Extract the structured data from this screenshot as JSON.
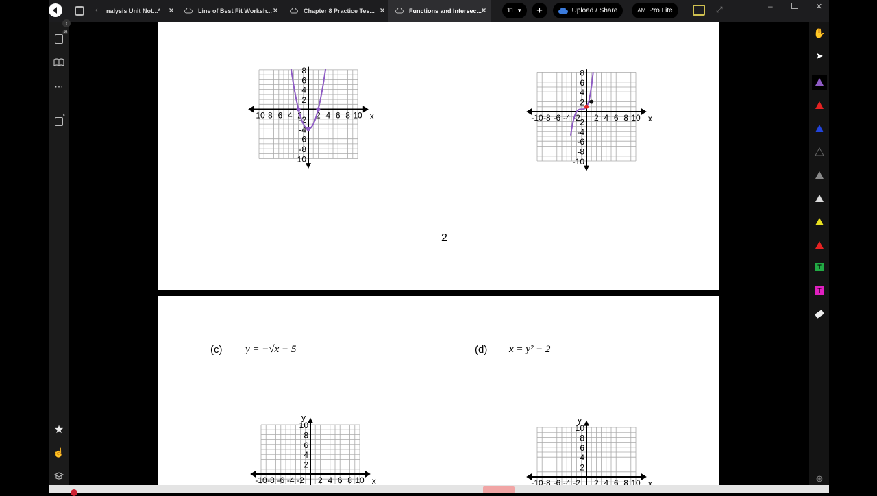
{
  "tabs": [
    {
      "label": "nalysis Unit Not...*",
      "cloud": false
    },
    {
      "label": "Line of Best Fit Worksh...",
      "cloud": true
    },
    {
      "label": "Chapter 8 Practice Tes...",
      "cloud": true
    },
    {
      "label": "Functions and Intersec...*",
      "cloud": true,
      "active": true
    }
  ],
  "page_count": "11",
  "upload_label": "Upload / Share",
  "plan_label": "Pro Lite",
  "avatar_initials": "AM",
  "left_badge": "10",
  "page_number": "2",
  "graphs_top": {
    "left": {
      "ticks": [
        "-10",
        "-8",
        "-6",
        "-4",
        "-2",
        "2",
        "4",
        "6",
        "8",
        "10"
      ],
      "yticks": [
        "8",
        "6",
        "4",
        "2",
        "-2",
        "-4",
        "-6",
        "-8",
        "-10"
      ],
      "xaxis": "x"
    },
    "right": {
      "ticks": [
        "-10",
        "-8",
        "-6",
        "-4",
        "-2",
        "2",
        "4",
        "6",
        "8",
        "10"
      ],
      "yticks": [
        "8",
        "6",
        "4",
        "2",
        "-2",
        "-4",
        "-6",
        "-8",
        "-10"
      ],
      "xaxis": "x"
    }
  },
  "problems": {
    "c": {
      "label": "(c)",
      "equation": "y = −√x − 5"
    },
    "d": {
      "label": "(d)",
      "equation": "x = y² − 2"
    }
  },
  "graphs_bottom": {
    "xticks": [
      "-10",
      "-8",
      "-6",
      "-4",
      "-2",
      "2",
      "4",
      "6",
      "8",
      "10"
    ],
    "yticks": [
      "10",
      "8",
      "6",
      "4",
      "2"
    ],
    "yaxis": "y",
    "xaxis": "x"
  },
  "colors": {
    "ink_purple": "#8e5bc4",
    "tab_bg": "#1d1d1f",
    "accent_blue": "#3b7bdc"
  }
}
